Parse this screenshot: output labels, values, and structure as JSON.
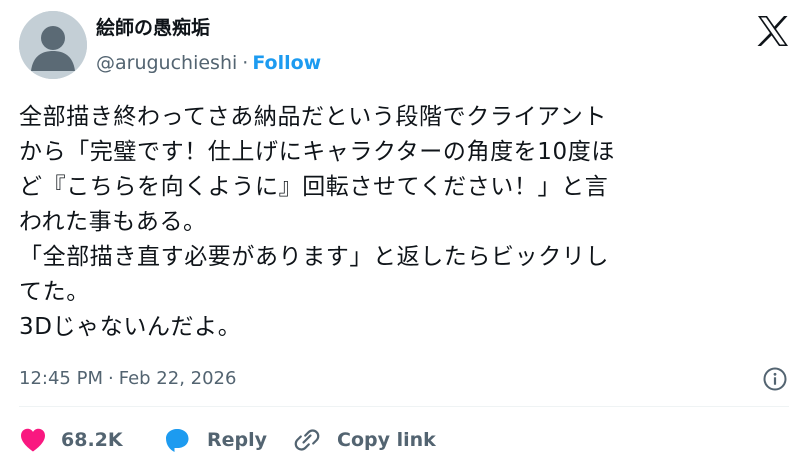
{
  "author": {
    "display_name": "絵師の愚痴垢",
    "handle": "@aruguchieshi",
    "separator": "·",
    "follow_label": "Follow"
  },
  "brand": {
    "logo_icon": "x-logo-icon",
    "follow_color": "#1d9bf0",
    "like_color": "#f91880"
  },
  "tweet": {
    "lines": [
      "全部描き終わってさあ納品だという段階でクライアント",
      "から「完璧です！仕上げにキャラクターの角度を10度ほ",
      "ど『こちらを向くように』回転させてください！」と言",
      "われた事もある。",
      "「全部描き直す必要があります」と返したらビックリし",
      "てた。",
      "3Dじゃないんだよ。"
    ]
  },
  "meta": {
    "time": "12:45 PM",
    "separator": "·",
    "date": "Feb 22, 2026",
    "info_icon": "info-icon"
  },
  "actions": {
    "likes_count": "68.2K",
    "reply_label": "Reply",
    "copy_link_label": "Copy link",
    "icons": [
      "heart-icon",
      "reply-bubble-icon",
      "link-icon"
    ]
  }
}
